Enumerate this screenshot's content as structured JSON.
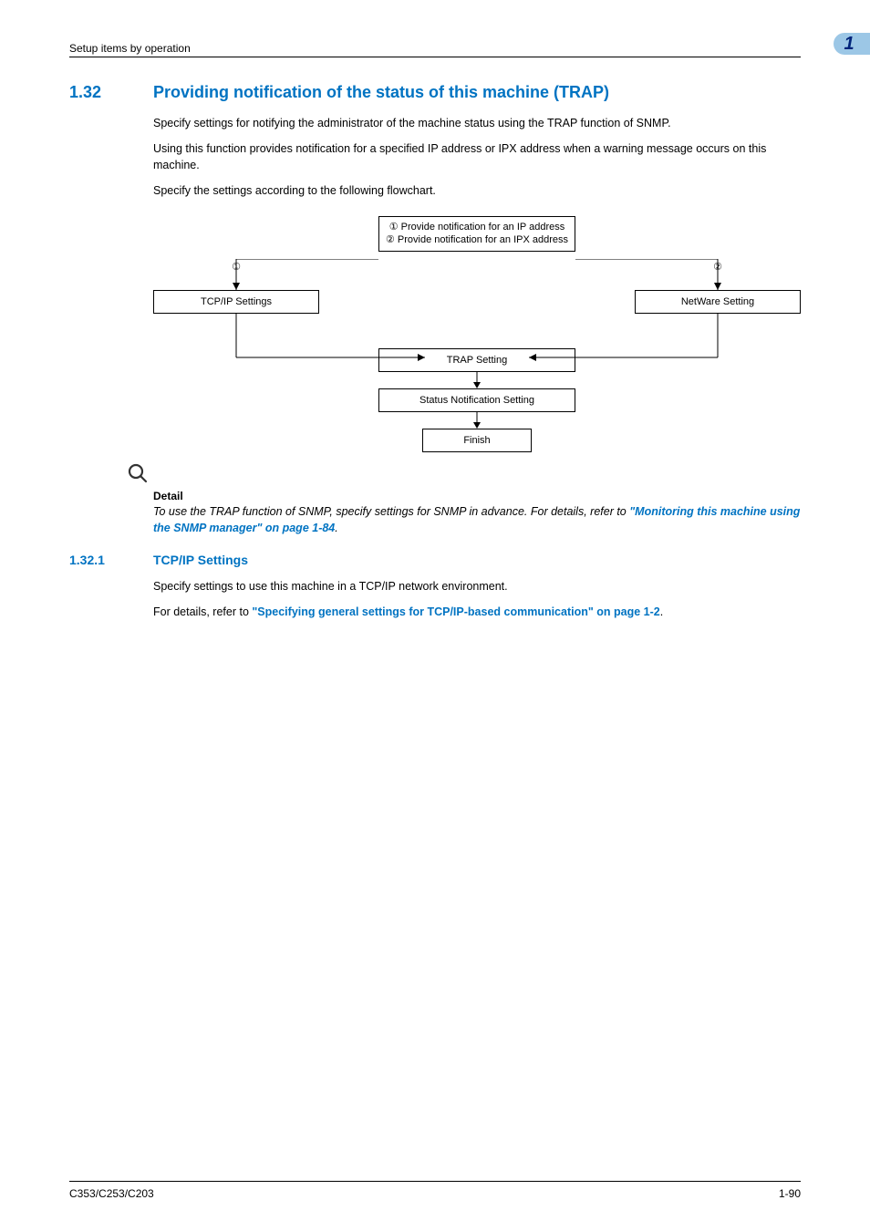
{
  "header": {
    "running": "Setup items by operation",
    "chapter": "1"
  },
  "section": {
    "number": "1.32",
    "title": "Providing notification of the status of this machine (TRAP)",
    "p1": "Specify settings for notifying the administrator of the machine status using the TRAP function of SNMP.",
    "p2": "Using this function provides notification for a specified IP address or IPX address when a warning message occurs on this machine.",
    "p3": "Specify the settings according to the following flowchart."
  },
  "flow": {
    "top_line1": "① Provide notification for an IP address",
    "top_line2": "② Provide notification for an IPX address",
    "label_left": "①",
    "label_right": "②",
    "box_left": "TCP/IP Settings",
    "box_right": "NetWare Setting",
    "box_trap": "TRAP Setting",
    "box_status": "Status Notification Setting",
    "box_finish": "Finish"
  },
  "detail": {
    "heading": "Detail",
    "body_pre": "To use the TRAP function of SNMP, specify settings for SNMP in advance. For details, refer to ",
    "body_link": "\"Monitoring this machine using the SNMP manager\" on page 1-84",
    "body_post": "."
  },
  "subsection": {
    "number": "1.32.1",
    "title": "TCP/IP Settings",
    "p1": "Specify settings to use this machine in a TCP/IP network environment.",
    "p2_pre": "For details, refer to ",
    "p2_link": "\"Specifying general settings for TCP/IP-based communication\" on page 1-2",
    "p2_post": "."
  },
  "footer": {
    "left": "C353/C253/C203",
    "right": "1-90"
  }
}
